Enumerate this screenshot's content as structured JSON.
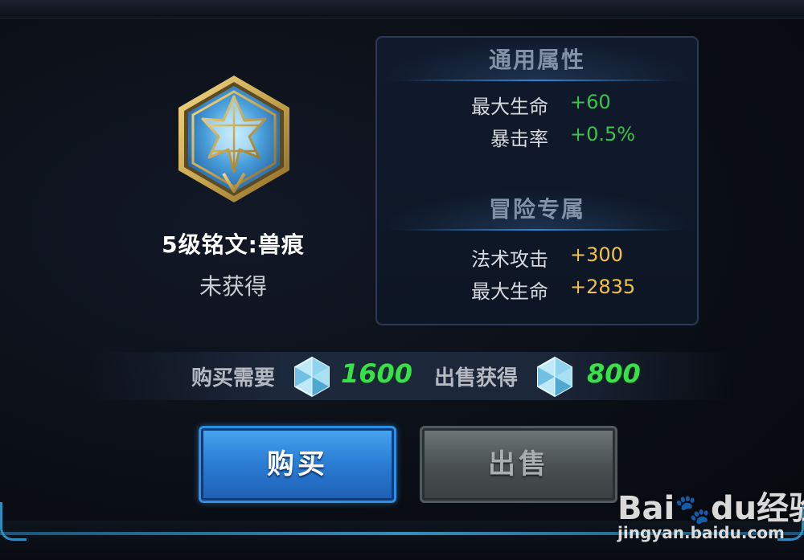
{
  "rune": {
    "title": "5级铭文:兽痕",
    "status": "未获得",
    "icon": "rune-emblem-icon",
    "colors": {
      "frame": "#c9a64e",
      "fill": "#3d86c4"
    }
  },
  "attributes": {
    "general": {
      "heading": "通用属性",
      "stats": [
        {
          "label": "最大生命",
          "value": "+60"
        },
        {
          "label": "暴击率",
          "value": "+0.5%"
        }
      ],
      "value_color": "#38c44c"
    },
    "adventure": {
      "heading": "冒险专属",
      "stats": [
        {
          "label": "法术攻击",
          "value": "+300"
        },
        {
          "label": "最大生命",
          "value": "+2835"
        }
      ],
      "value_color": "#f1c24a"
    }
  },
  "pricing": {
    "buy_label": "购买需要",
    "buy_cost": "1600",
    "sell_label": "出售获得",
    "sell_gain": "800",
    "currency_icon": "crystal-gem-icon",
    "value_color": "#39e04a"
  },
  "actions": {
    "buy_button": "购买",
    "sell_button": "出售"
  },
  "watermark": {
    "logo": "Bai",
    "logo_mid": "du",
    "logo_suffix": "经验",
    "url": "jingyan.baidu.com"
  }
}
